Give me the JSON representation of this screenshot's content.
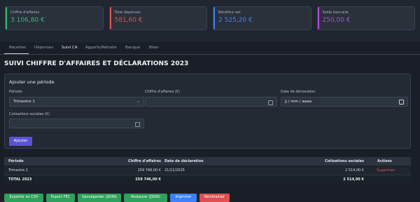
{
  "summary": {
    "cards": [
      {
        "label": "Chiffre d'affaires",
        "value": "3 106,80 €",
        "color": "#2fbf71"
      },
      {
        "label": "Total dépenses",
        "value": "581,60 €",
        "color": "#e04f4f"
      },
      {
        "label": "Bénéfice net",
        "value": "2 525,20 €",
        "color": "#3b82f6"
      },
      {
        "label": "Solde bancaire",
        "value": "250,00 €",
        "color": "#b247e0"
      }
    ]
  },
  "tabs": [
    {
      "label": "Recettes"
    },
    {
      "label": "Dépenses"
    },
    {
      "label": "Suivi CA"
    },
    {
      "label": "Apports/Retraits"
    },
    {
      "label": "Banque"
    },
    {
      "label": "Bilan"
    }
  ],
  "page": {
    "title": "SUIVI CHIFFRE D'AFFAIRES ET DÉCLARATIONS 2023"
  },
  "form": {
    "title": "Ajouter une période",
    "period_label": "Période",
    "period_value": "Trimestre 1",
    "revenue_label": "Chiffre d'affaires (€)",
    "revenue_value": "",
    "date_label": "Date de déclaration",
    "date_placeholder": "jj / mm / aaaa",
    "social_label": "Cotisations sociales (€)",
    "social_value": "",
    "add_button": "Ajouter"
  },
  "table": {
    "headers": [
      "Période",
      "Chiffre d'affaires",
      "Date de déclaration",
      "Cotisations sociales",
      "Actions"
    ],
    "rows": [
      {
        "period": "Trimestre 1",
        "revenue": "259 746,00 €",
        "date": "21/11/2025",
        "social": "2 514,00 €",
        "action": "Supprimer"
      }
    ],
    "total": {
      "label": "TOTAL 2023",
      "revenue": "259 746,00 €",
      "social": "2 514,00 €"
    }
  },
  "actions": [
    {
      "label": "Exporter en CSV",
      "color": "#2ea15a"
    },
    {
      "label": "Export FEC",
      "color": "#2ea15a"
    },
    {
      "label": "Sauvegarder (JSON)",
      "color": "#2ea15a"
    },
    {
      "label": "Restaurer (JSON)",
      "color": "#2ea15a"
    },
    {
      "label": "Imprimer",
      "color": "#3b82f6"
    },
    {
      "label": "Réinitialiser",
      "color": "#e04f4f"
    }
  ]
}
